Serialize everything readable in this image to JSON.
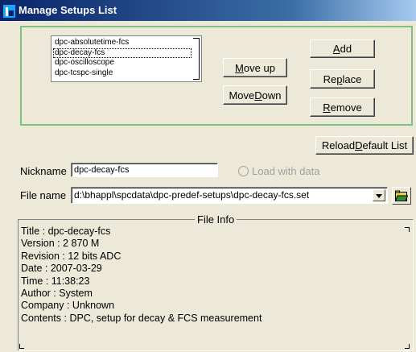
{
  "window": {
    "title": "Manage Setups List",
    "icon": "app-icon"
  },
  "setups": {
    "items": [
      "dpc-absolutetime-fcs",
      "dpc-decay-fcs",
      "dpc-oscilloscope",
      "dpc-tcspc-single"
    ],
    "selected_index": 1
  },
  "buttons": {
    "add": {
      "prefix": "",
      "accel": "A",
      "suffix": "dd"
    },
    "move_up": {
      "prefix": "",
      "accel": "M",
      "suffix": "ove up"
    },
    "replace": {
      "prefix": "Re",
      "accel": "p",
      "suffix": "lace"
    },
    "move_down": {
      "prefix": "Move ",
      "accel": "D",
      "suffix": "own"
    },
    "remove": {
      "prefix": "",
      "accel": "R",
      "suffix": "emove"
    },
    "reload": {
      "prefix": "Reload ",
      "accel": "D",
      "suffix": "efault List"
    }
  },
  "nickname": {
    "label": "Nickname",
    "value": "dpc-decay-fcs"
  },
  "load_with_data": {
    "label": "Load with data",
    "checked": false
  },
  "file_name": {
    "label": "File name",
    "value": "d:\\bhappl\\spcdata\\dpc-predef-setups\\dpc-decay-fcs.set"
  },
  "file_info": {
    "legend": "File Info",
    "lines": [
      "Title : dpc-decay-fcs",
      "Version : 2 870 M",
      "Revision : 12 bits ADC",
      "Date : 2007-03-29",
      "Time : 11:38:23",
      "Author : System",
      "Company : Unknown",
      "Contents : DPC, setup for decay & FCS measurement"
    ]
  },
  "colors": {
    "titlebar": "#0a246a",
    "group_border": "#7fbf7f",
    "window_bg": "#ece9d8"
  }
}
